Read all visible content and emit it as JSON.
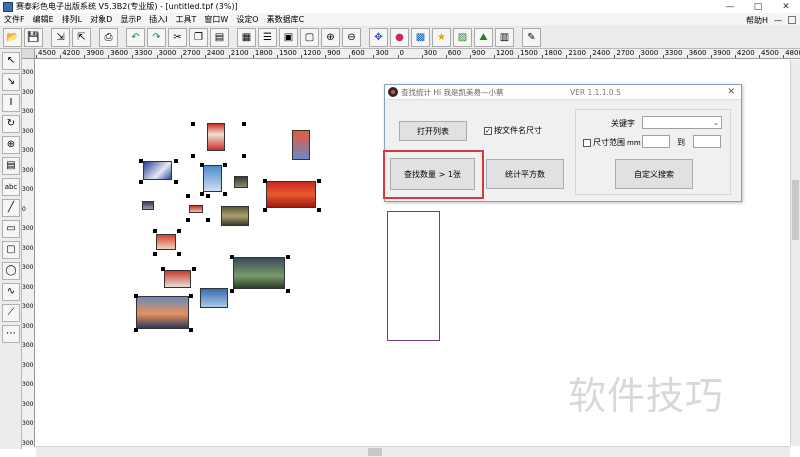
{
  "window": {
    "title": "赛泰彩色电子出版系统 V5.3B2(专业版) - [untitled.tpf (3%)]",
    "min_glyph": "—",
    "max_glyph": "□",
    "close_glyph": "✕"
  },
  "menubar": {
    "items": [
      "文件F",
      "编辑E",
      "排列L",
      "对象D",
      "显示P",
      "插入I",
      "工具T",
      "窗口W",
      "设定O",
      "素数据库C"
    ],
    "help": "帮助H",
    "minus": "—"
  },
  "toolbar": {
    "icons": [
      "open-folder-icon",
      "save-icon",
      "import-icon",
      "export-icon",
      "print-icon",
      "undo-icon",
      "redo-icon",
      "cut-icon",
      "copy-icon",
      "paste-icon",
      "layout-icon",
      "align-icon",
      "group-icon",
      "ungroup-icon",
      "zoom-in-icon",
      "zoom-out-icon",
      "move-icon",
      "color-icon",
      "image-icon",
      "star-icon",
      "photo-icon",
      "chart-icon",
      "stats-icon"
    ]
  },
  "rulers": {
    "horizontal": [
      "4500",
      "4200",
      "3900",
      "3600",
      "3300",
      "3000",
      "2700",
      "2400",
      "2100",
      "1800",
      "1500",
      "1200",
      "900",
      "600",
      "300",
      "0",
      "300",
      "600",
      "900",
      "1200",
      "1500",
      "1800",
      "2100",
      "2400",
      "2700",
      "3000",
      "3300",
      "3600",
      "3900",
      "4200",
      "4500",
      "4800",
      "5100"
    ],
    "vertical": [
      "300",
      "300",
      "300",
      "300",
      "300",
      "300",
      "300",
      "0",
      "300",
      "300",
      "300",
      "300",
      "300",
      "300",
      "300",
      "300",
      "300",
      "300",
      "300",
      "300"
    ]
  },
  "tools": {
    "icons": [
      "pointer-icon",
      "node-icon",
      "text-icon",
      "rotate-icon",
      "zoom-icon",
      "page-icon",
      "abc-text-icon",
      "line-icon",
      "rectangle-icon",
      "rounded-rect-icon",
      "ellipse-icon",
      "curve-icon",
      "polyline-icon",
      "table-icon"
    ],
    "abc_label": "abc"
  },
  "dialog": {
    "title": "查找统计 Hi 我是凯美易—小蔡",
    "version": "VER 1.1.1.0.5",
    "close_glyph": "✕",
    "open_list_button": "打开列表",
    "by_filename_size_label": "按文件名尺寸",
    "by_filename_size_checked": true,
    "find_count_button": "查找数量 > 1张",
    "count_area_button": "统计平方数",
    "keyword_label": "关键字",
    "keyword_value": "",
    "size_range_label": "尺寸范围",
    "size_range_unit": "mm",
    "size_range_checked": false,
    "size_from": "",
    "to_label": "到",
    "size_to": "",
    "custom_search_button": "自定义搜索"
  },
  "watermark": "软件技巧"
}
